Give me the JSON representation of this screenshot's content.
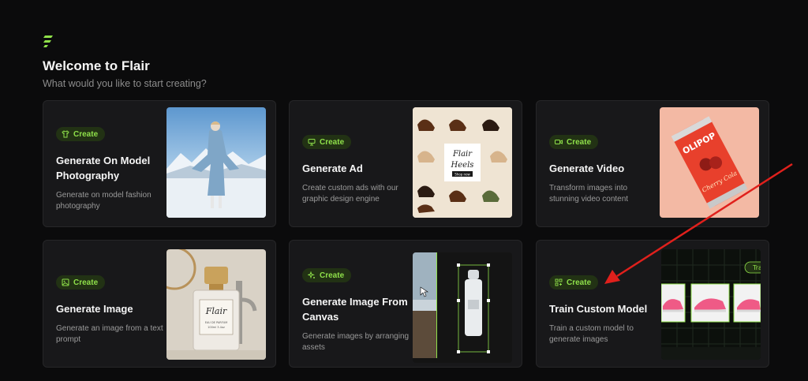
{
  "header": {
    "title": "Welcome to Flair",
    "subtitle": "What would you like to start creating?"
  },
  "cards": [
    {
      "pill": "Create",
      "title": "Generate On Model Photography",
      "desc": "Generate on model fashion photography",
      "icon": "shirt-icon"
    },
    {
      "pill": "Create",
      "title": "Generate Ad",
      "desc": "Create custom ads with our graphic design engine",
      "icon": "ad-icon"
    },
    {
      "pill": "Create",
      "title": "Generate Video",
      "desc": "Transform images into stunning video content",
      "icon": "video-icon"
    },
    {
      "pill": "Create",
      "title": "Generate Image",
      "desc": "Generate an image from a text prompt",
      "icon": "image-icon"
    },
    {
      "pill": "Create",
      "title": "Generate Image From Canvas",
      "desc": "Generate images by arranging assets",
      "icon": "sparkle-icon"
    },
    {
      "pill": "Create",
      "title": "Train Custom Model",
      "desc": "Train a custom model to generate images",
      "icon": "grid-icon"
    }
  ],
  "thumbs": {
    "ad_sign_line1": "Flair",
    "ad_sign_line2": "Heels",
    "ad_sign_cta": "Shop now",
    "soda_brand": "OLIPOP",
    "soda_flavor": "Cherry Cola",
    "perfume_brand": "Flair",
    "perfume_line1": "EAU DE PARFUM",
    "perfume_line2": "100ml 3.4oz",
    "train_badge": "Tra"
  },
  "colors": {
    "accent": "#8fe04a",
    "pill_bg": "#223214",
    "card_bg": "#18181a",
    "annotation_arrow": "#e0201c"
  }
}
